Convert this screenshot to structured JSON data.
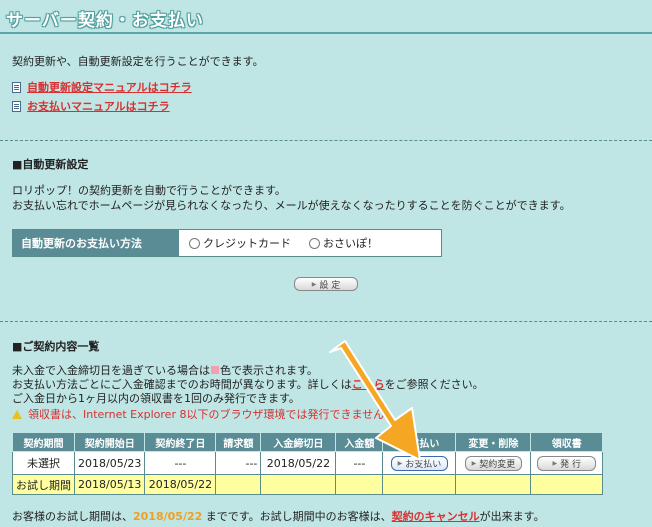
{
  "page": {
    "title": "サーバー契約・お支払い",
    "intro": "契約更新や、自動更新設定を行うことができます。",
    "links": [
      {
        "label": "自動更新設定マニュアルはコチラ"
      },
      {
        "label": "お支払いマニュアルはコチラ"
      }
    ]
  },
  "auto_renew": {
    "heading": "■自動更新設定",
    "desc1": "ロリポップ！の契約更新を自動で行うことができます。",
    "desc2": "お支払い忘れでホームページが見られなくなったり、メールが使えなくなったりすることを防ぐことができます。",
    "method_label": "自動更新のお支払い方法",
    "options": [
      "クレジットカード",
      "おさいぽ！"
    ],
    "submit_label": "設 定"
  },
  "contracts": {
    "heading": "■ご契約内容一覧",
    "note1_pre": "未入金で入金締切日を過ぎている場合は",
    "note1_post": "色で表示されます。",
    "note2_pre": "お支払い方法ごとにご入金確認までのお時間が異なります。詳しくは",
    "note2_link": "こちら",
    "note2_post": "をご参照ください。",
    "note3": "ご入金日から1ヶ月以内の領収書を1回のみ発行できます。",
    "warning": "領収書は、Internet Explorer 8以下のブラウザ環境では発行できません。",
    "headers": [
      "契約期間",
      "契約開始日",
      "契約終了日",
      "請求額",
      "入金締切日",
      "入金額",
      "お支払い",
      "変更・削除",
      "領収書"
    ],
    "row": {
      "period": "未選択",
      "start": "2018/05/23",
      "end": "---",
      "amount": "---",
      "deadline": "2018/05/22",
      "paid": "---",
      "pay_btn": "お支払い",
      "change_btn": "契約変更",
      "receipt_btn": "発 行"
    },
    "trial_row": {
      "label": "お試し期間",
      "start": "2018/05/13",
      "end": "2018/05/22"
    },
    "footer_pre": "お客様のお試し期間は、",
    "footer_date": "2018/05/22",
    "footer_mid": " までです。お試し期間中のお客様は、",
    "footer_link": "契約のキャンセル",
    "footer_post": "が出来ます。"
  },
  "colors": {
    "accent": "#5a8c96",
    "background": "#bfe5e4",
    "link_red": "#d83030",
    "arrow": "#f5a623",
    "trial_yellow": "#ffffa0"
  }
}
